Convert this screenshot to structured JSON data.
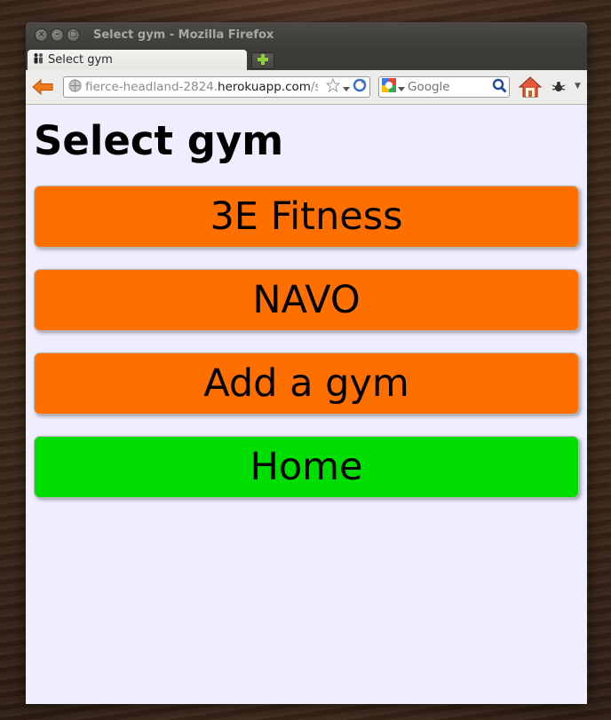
{
  "window": {
    "title": "Select gym - Mozilla Firefox",
    "controls": {
      "close_glyph": "×",
      "minimize_glyph": "–",
      "maximize_glyph": "□"
    }
  },
  "tab": {
    "label": "Select gym",
    "icon": "people-favicon-icon"
  },
  "navbar": {
    "url_path_prefix": "fierce-headland-2824.",
    "url_host": "herokuapp.com",
    "url_suffix": "/s",
    "search_placeholder": "Google",
    "icons": [
      "back-arrow-icon",
      "globe-icon",
      "bookmark-star-icon",
      "reload-icon",
      "google-icon",
      "magnifier-icon",
      "home-icon",
      "addon-bug-icon"
    ]
  },
  "page": {
    "title": "Select gym",
    "buttons": [
      {
        "label": "3E Fitness",
        "color": "#ff6f00"
      },
      {
        "label": "NAVO",
        "color": "#ff6f00"
      },
      {
        "label": "Add a gym",
        "color": "#ff6f00"
      },
      {
        "label": "Home",
        "color": "#00dd00"
      }
    ]
  },
  "colors": {
    "page_background": "#eeeefe",
    "accent_orange": "#ff6f00",
    "accent_green": "#00dd00",
    "titlebar": "#3c3b37"
  }
}
